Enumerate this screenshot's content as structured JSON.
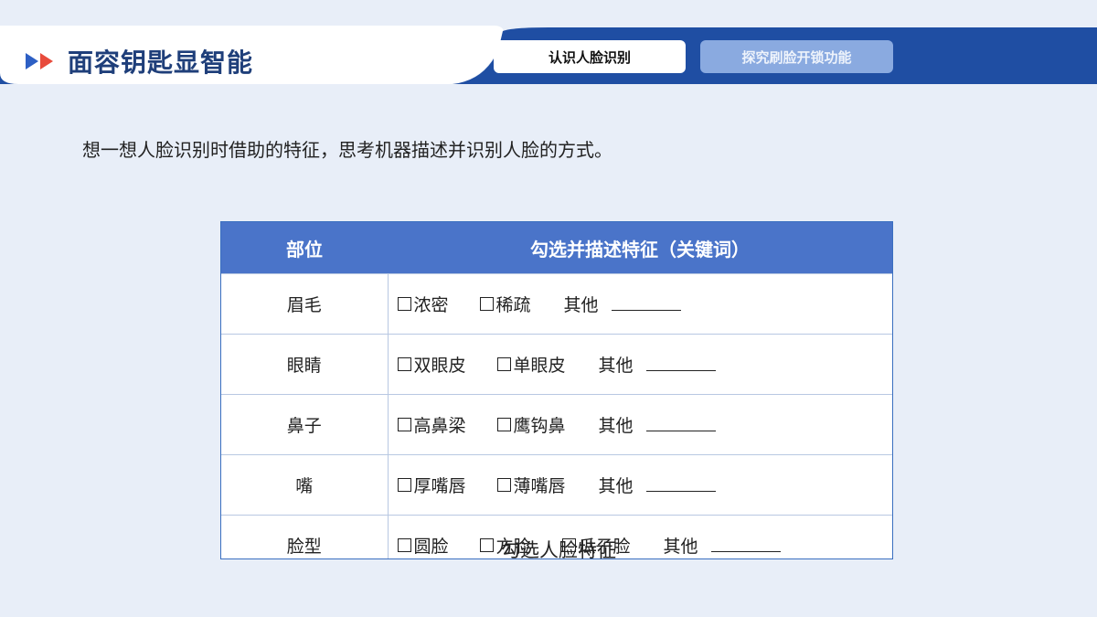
{
  "header": {
    "title": "面容钥匙显智能",
    "tabs": [
      {
        "label": "认识人脸识别",
        "active": true
      },
      {
        "label": "探究刷脸开锁功能",
        "active": false
      }
    ]
  },
  "prompt": "想一想人脸识别时借助的特征，思考机器描述并识别人脸的方式。",
  "table": {
    "headers": [
      "部位",
      "勾选并描述特征（关键词）"
    ],
    "rows": [
      {
        "part": "眉毛",
        "options": [
          "浓密",
          "稀疏"
        ],
        "other": "其他"
      },
      {
        "part": "眼睛",
        "options": [
          "双眼皮",
          "单眼皮"
        ],
        "other": "其他"
      },
      {
        "part": "鼻子",
        "options": [
          "高鼻梁",
          "鹰钩鼻"
        ],
        "other": "其他"
      },
      {
        "part": "嘴",
        "options": [
          "厚嘴唇",
          "薄嘴唇"
        ],
        "other": "其他"
      },
      {
        "part": "脸型",
        "options": [
          "圆脸",
          "方脸",
          "瓜子脸"
        ],
        "other": "其他"
      }
    ]
  },
  "caption": "勾选人脸特征",
  "colors": {
    "accent": "#1f4ea3",
    "header": "#4a74c9",
    "chevron_blue": "#2d5fc4",
    "chevron_red": "#e84b3c"
  }
}
